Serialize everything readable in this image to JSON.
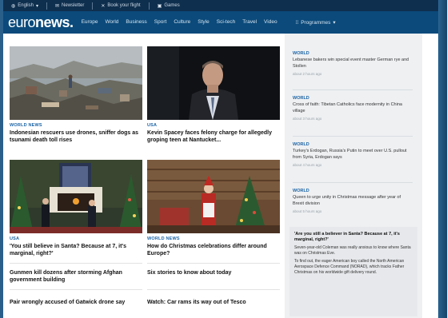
{
  "topbar": {
    "language": "English",
    "newsletter": "Newsletter",
    "flight": "Book your flight",
    "games": "Games"
  },
  "header": {
    "logo_light": "euro",
    "logo_bold": "news.",
    "nav": [
      "Europe",
      "World",
      "Business",
      "Sport",
      "Culture",
      "Style",
      "Sci-tech",
      "Travel",
      "Video"
    ],
    "programmes": "Programmes"
  },
  "articles": [
    {
      "category": "WORLD NEWS",
      "headline": "Indonesian rescuers use drones, sniffer dogs as tsunami death toll rises"
    },
    {
      "category": "USA",
      "headline": "Kevin Spacey faces felony charge for allegedly groping teen at Nantucket..."
    },
    {
      "category": "USA",
      "headline": "'You still believe in Santa? Because at 7, it's marginal, right?'"
    },
    {
      "category": "WORLD NEWS",
      "headline": "How do Christmas celebrations differ around Europe?"
    }
  ],
  "plain_headlines": [
    "Gunmen kill dozens after storming Afghan government building",
    "Six stories to know about today",
    "Pair wrongly accused of Gatwick drone say",
    "Watch: Car rams its way out of Tesco"
  ],
  "sidebar": {
    "items": [
      {
        "category": "WORLD",
        "text": "Lebanese bakers win special event master German rye and Stollen",
        "time": "about 2 hours ago"
      },
      {
        "category": "WORLD",
        "text": "Cross of faith: Tibetan Catholics face modernity in China village",
        "time": "about 3 hours ago"
      },
      {
        "category": "WORLD",
        "text": "Turkey's Erdogan, Russia's Putin to meet over U.S. pullout from Syria, Erdogan says",
        "time": "about 4 hours ago"
      },
      {
        "category": "WORLD",
        "text": "Queen to urge unity in Christmas message after year of Brexit division",
        "time": "about 5 hours ago"
      }
    ],
    "featured_title": "'Are you still a believer in Santa? Because at 7, it's marginal, right?'",
    "featured_body1": "Seven-year-old Coleman was really anxious to know where Santa was on Christmas Eve.",
    "featured_body2": "To find out, the eager American boy called the North American Aerospace Defence Command (NORAD), which tracks Father Christmas on his worldwide gift delivery round."
  }
}
